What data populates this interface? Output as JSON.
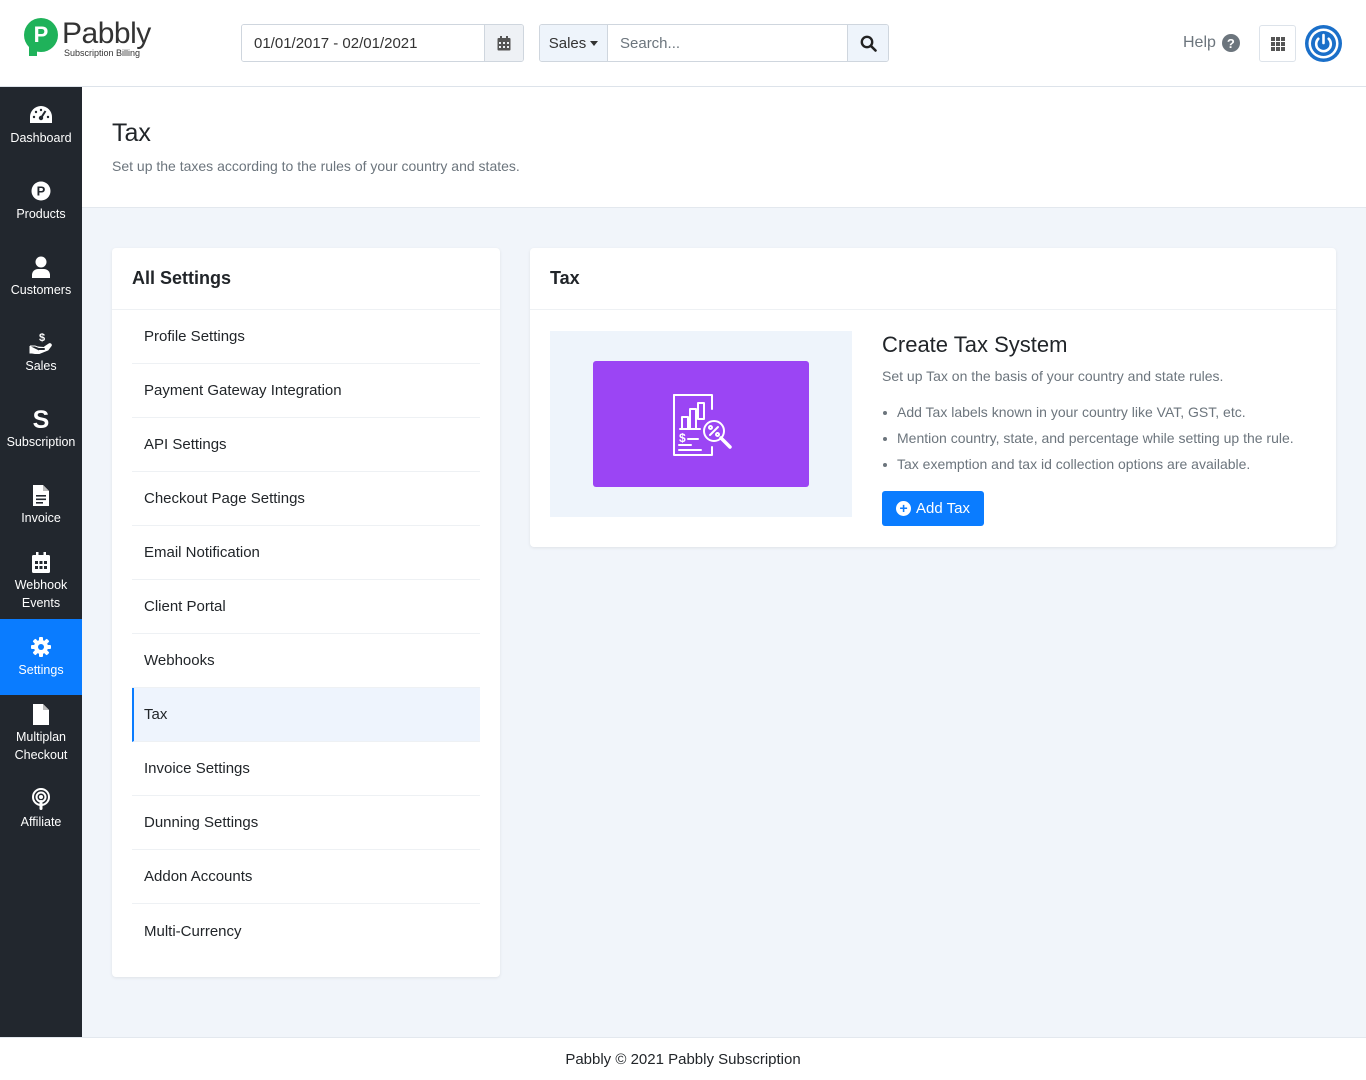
{
  "brand": {
    "name": "Pabbly",
    "tagline": "Subscription Billing",
    "logo_letter": "P",
    "color": "#1fb25a"
  },
  "header": {
    "date_range": "01/01/2017 - 02/01/2021",
    "search_type": "Sales",
    "search_placeholder": "Search...",
    "help_label": "Help",
    "help_glyph": "?"
  },
  "sidebar": {
    "items": [
      {
        "label": "Dashboard",
        "icon": "tachometer-icon"
      },
      {
        "label": "Products",
        "icon": "product-p-icon"
      },
      {
        "label": "Customers",
        "icon": "user-icon"
      },
      {
        "label": "Sales",
        "icon": "hand-coin-icon"
      },
      {
        "label": "Subscription",
        "icon": "dollar-s-icon"
      },
      {
        "label": "Invoice",
        "icon": "file-text-icon"
      },
      {
        "label": "Webhook Events",
        "icon": "calendar-icon"
      },
      {
        "label": "Settings",
        "icon": "gear-icon",
        "active": true
      },
      {
        "label": "Multiplan Checkout",
        "icon": "file-icon"
      },
      {
        "label": "Affiliate",
        "icon": "podcast-icon"
      }
    ]
  },
  "page": {
    "title": "Tax",
    "subtitle": "Set up the taxes according to the rules of your country and states."
  },
  "settings": {
    "title": "All Settings",
    "items": [
      "Profile Settings",
      "Payment Gateway Integration",
      "API Settings",
      "Checkout Page Settings",
      "Email Notification",
      "Client Portal",
      "Webhooks",
      "Tax",
      "Invoice Settings",
      "Dunning Settings",
      "Addon Accounts",
      "Multi-Currency"
    ],
    "active": "Tax"
  },
  "tax_card": {
    "title": "Tax",
    "heading": "Create Tax System",
    "description": "Set up Tax on the basis of your country and state rules.",
    "bullets": [
      "Add Tax labels known in your country like VAT, GST, etc.",
      "Mention country, state, and percentage while setting up the rule.",
      "Tax exemption and tax id collection options are available."
    ],
    "button_label": "Add Tax",
    "button_glyph": "+",
    "illustration_color": "#9b45f4"
  },
  "footer": {
    "text": "Pabbly © 2021 Pabbly Subscription"
  },
  "colors": {
    "accent": "#0a7cff",
    "sidebar_bg": "#22272e",
    "page_bg": "#f1f5fa"
  }
}
